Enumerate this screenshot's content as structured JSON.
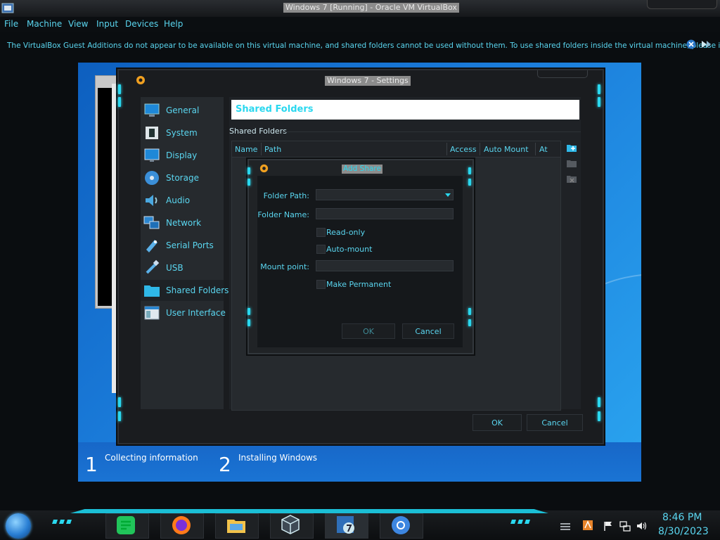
{
  "host": {
    "title": "Windows 7 [Running] - Oracle VM VirtualBox",
    "menu": [
      "File",
      "Machine",
      "View",
      "Input",
      "Devices",
      "Help"
    ],
    "notice": "The VirtualBox Guest Additions do not appear to be available on this virtual machine, and shared folders cannot be used without them. To use shared folders inside the virtual machine, please install"
  },
  "guest": {
    "steps": [
      {
        "num": "1",
        "label": "Collecting information"
      },
      {
        "num": "2",
        "label": "Installing Windows"
      }
    ]
  },
  "settings": {
    "title": "Windows 7 - Settings",
    "sidebar": [
      {
        "label": "General",
        "icon": "monitor-icon"
      },
      {
        "label": "System",
        "icon": "chip-icon"
      },
      {
        "label": "Display",
        "icon": "display-icon"
      },
      {
        "label": "Storage",
        "icon": "disk-icon"
      },
      {
        "label": "Audio",
        "icon": "speaker-icon"
      },
      {
        "label": "Network",
        "icon": "network-icon"
      },
      {
        "label": "Serial Ports",
        "icon": "serial-port-icon"
      },
      {
        "label": "USB",
        "icon": "usb-icon"
      },
      {
        "label": "Shared Folders",
        "icon": "folder-icon"
      },
      {
        "label": "User Interface",
        "icon": "window-icon"
      }
    ],
    "active_item": "Shared Folders",
    "page_header": "Shared Folders",
    "section_label": "Shared Folders",
    "table_columns": [
      "Name",
      "Path",
      "Access",
      "Auto Mount",
      "At"
    ],
    "ok_label": "OK",
    "cancel_label": "Cancel"
  },
  "add_share": {
    "title": "Add Share",
    "folder_path_label": "Folder Path:",
    "folder_path_value": "",
    "folder_name_label": "Folder Name:",
    "folder_name_value": "",
    "readonly_label": "Read-only",
    "automount_label": "Auto-mount",
    "mountpoint_label": "Mount point:",
    "mountpoint_value": "",
    "permanent_label": "Make Permanent",
    "ok_label": "OK",
    "cancel_label": "Cancel"
  },
  "taskbar": {
    "time": "8:46 PM",
    "date": "8/30/2023",
    "apps": [
      "spreadsheet-app-icon",
      "firefox-icon",
      "file-explorer-icon",
      "virtualbox-icon",
      "windows7-vm-icon",
      "chrome-icon"
    ]
  },
  "colors": {
    "accent": "#2ad8ef",
    "label": "#5ad6f0",
    "panel": "#1a1c1f"
  }
}
